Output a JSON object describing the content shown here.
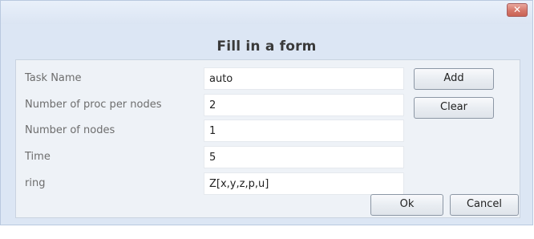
{
  "window": {
    "close_glyph": "✕"
  },
  "form": {
    "title": "Fill in a form",
    "fields": [
      {
        "label": "Task Name",
        "value": "auto"
      },
      {
        "label": "Number of proc per nodes",
        "value": "2"
      },
      {
        "label": "Number of nodes",
        "value": "1"
      },
      {
        "label": "Time",
        "value": "5"
      },
      {
        "label": "ring",
        "value": "Z[x,y,z,p,u]"
      }
    ]
  },
  "buttons": {
    "add": "Add",
    "clear": "Clear",
    "ok": "Ok",
    "cancel": "Cancel"
  },
  "colors": {
    "dialog_bg": "#dce6f4",
    "panel_bg": "#eef2f7",
    "close_button": "#d5776a"
  }
}
